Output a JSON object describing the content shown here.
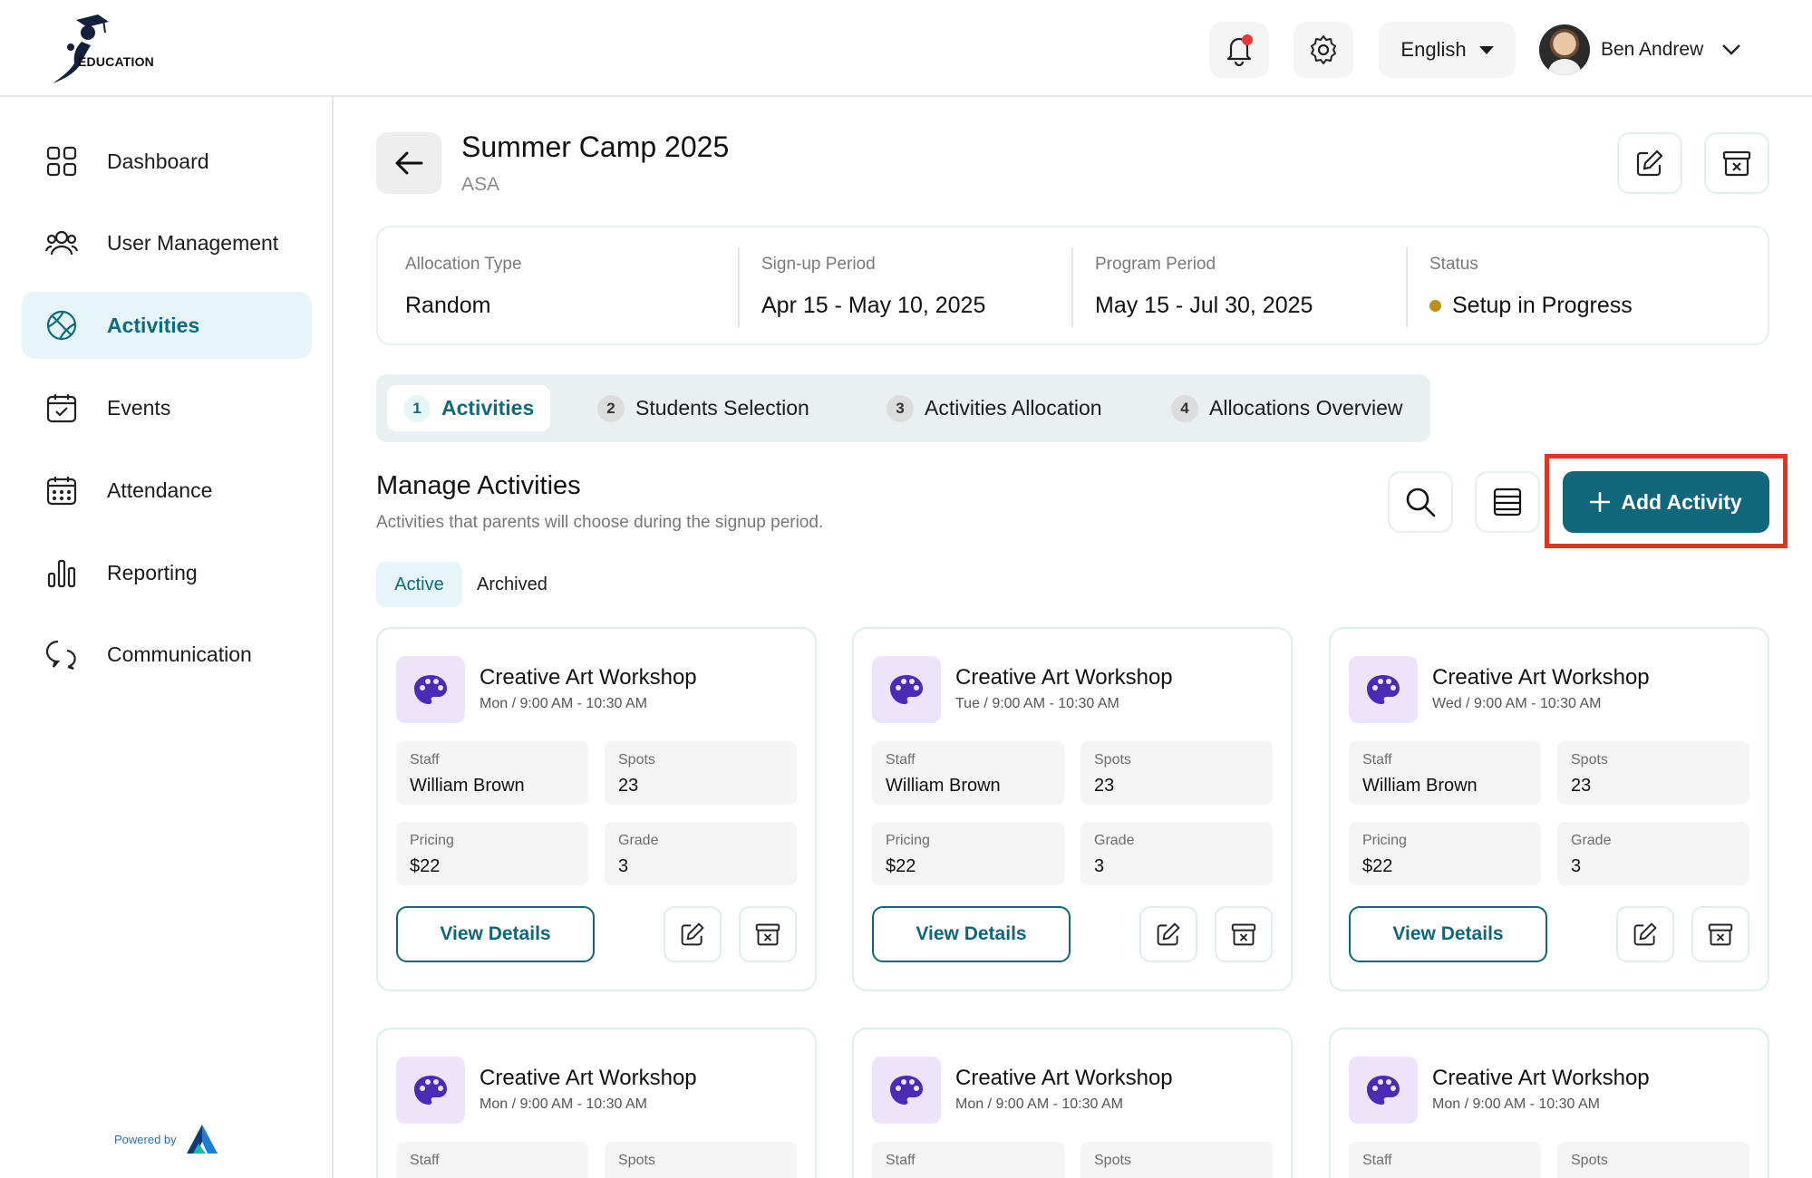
{
  "header": {
    "logo_text": "EDUCATION",
    "language": "English",
    "user_name": "Ben Andrew"
  },
  "sidebar": {
    "items": [
      {
        "label": "Dashboard",
        "icon": "dashboard-icon"
      },
      {
        "label": "User Management",
        "icon": "users-icon"
      },
      {
        "label": "Activities",
        "icon": "activities-icon",
        "active": true
      },
      {
        "label": "Events",
        "icon": "calendar-check-icon"
      },
      {
        "label": "Attendance",
        "icon": "calendar-grid-icon"
      },
      {
        "label": "Reporting",
        "icon": "bar-chart-icon"
      },
      {
        "label": "Communication",
        "icon": "chat-icon"
      }
    ],
    "powered_by": "Powered by"
  },
  "page": {
    "title": "Summer Camp 2025",
    "subtitle": "ASA"
  },
  "info": {
    "allocation_type_label": "Allocation Type",
    "allocation_type": "Random",
    "signup_label": "Sign-up Period",
    "signup_period": "Apr 15 - May 10, 2025",
    "program_label": "Program Period",
    "program_period": "May 15 - Jul 30, 2025",
    "status_label": "Status",
    "status": "Setup in Progress",
    "status_color": "#c08f12"
  },
  "steps": [
    {
      "num": "1",
      "label": "Activities",
      "active": true
    },
    {
      "num": "2",
      "label": "Students Selection"
    },
    {
      "num": "3",
      "label": "Activities Allocation"
    },
    {
      "num": "4",
      "label": "Allocations Overview"
    }
  ],
  "manage": {
    "title": "Manage Activities",
    "description": "Activities that parents will choose during the signup period.",
    "add_label": "Add Activity",
    "filter_active": "Active",
    "filter_archived": "Archived"
  },
  "cards": [
    {
      "title": "Creative Art Workshop",
      "time": "Mon / 9:00 AM - 10:30 AM",
      "staff_label": "Staff",
      "staff": "William Brown",
      "spots_label": "Spots",
      "spots": "23",
      "pricing_label": "Pricing",
      "pricing": "$22",
      "grade_label": "Grade",
      "grade": "3",
      "view_label": "View Details"
    },
    {
      "title": "Creative Art Workshop",
      "time": "Tue / 9:00 AM - 10:30 AM",
      "staff_label": "Staff",
      "staff": "William Brown",
      "spots_label": "Spots",
      "spots": "23",
      "pricing_label": "Pricing",
      "pricing": "$22",
      "grade_label": "Grade",
      "grade": "3",
      "view_label": "View Details"
    },
    {
      "title": "Creative Art Workshop",
      "time": "Wed / 9:00 AM - 10:30 AM",
      "staff_label": "Staff",
      "staff": "William Brown",
      "spots_label": "Spots",
      "spots": "23",
      "pricing_label": "Pricing",
      "pricing": "$22",
      "grade_label": "Grade",
      "grade": "3",
      "view_label": "View Details"
    },
    {
      "title": "Creative Art Workshop",
      "time": "Mon / 9:00 AM - 10:30 AM",
      "staff_label": "Staff",
      "spots_label": "Spots"
    },
    {
      "title": "Creative Art Workshop",
      "time": "Mon / 9:00 AM - 10:30 AM",
      "staff_label": "Staff",
      "spots_label": "Spots"
    },
    {
      "title": "Creative Art Workshop",
      "time": "Mon / 9:00 AM - 10:30 AM",
      "staff_label": "Staff",
      "spots_label": "Spots"
    }
  ],
  "colors": {
    "accent": "#10667a",
    "active_bg": "#e6f6f8",
    "highlight": "#e53422",
    "notification_dot": "#e53935"
  }
}
